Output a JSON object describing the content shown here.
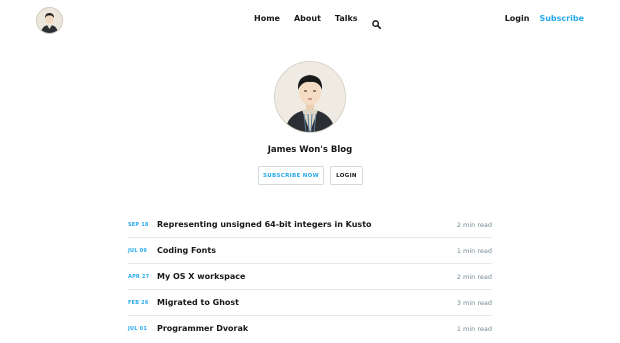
{
  "header": {
    "nav": [
      "Home",
      "About",
      "Talks"
    ],
    "login": "Login",
    "subscribe": "Subscribe"
  },
  "site": {
    "title": "James Won's Blog",
    "subscribe_button": "SUBSCRIBE NOW",
    "login_button": "LOGIN"
  },
  "posts": [
    {
      "date": "SEP 18",
      "title": "Representing unsigned 64-bit integers in Kusto",
      "read": "2 min read"
    },
    {
      "date": "JUL 09",
      "title": "Coding Fonts",
      "read": "1 min read"
    },
    {
      "date": "APR 27",
      "title": "My OS X workspace",
      "read": "2 min read"
    },
    {
      "date": "FEB 26",
      "title": "Migrated to Ghost",
      "read": "3 min read"
    },
    {
      "date": "JUL 01",
      "title": "Programmer Dvorak",
      "read": "1 min read"
    }
  ],
  "icons": {
    "search": "search-icon",
    "logo": "avatar-icon"
  },
  "colors": {
    "accent": "#26a8ed",
    "text": "#15171a",
    "muted": "#738a94"
  }
}
